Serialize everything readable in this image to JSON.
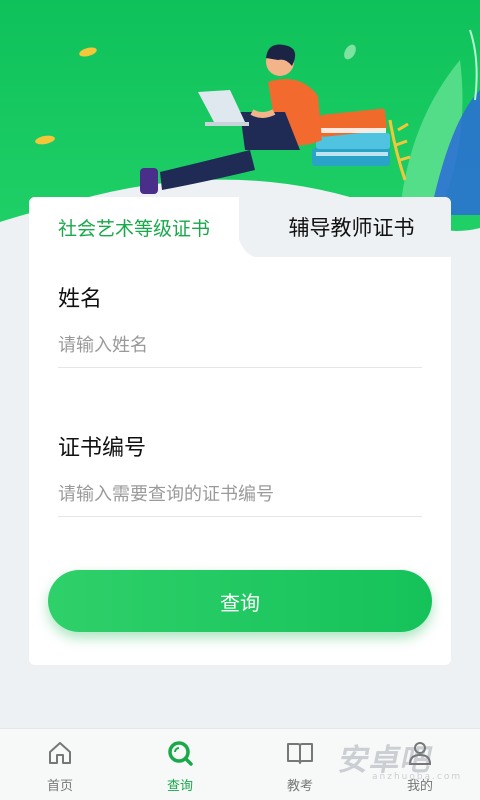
{
  "colors": {
    "brand_green": "#19a94a",
    "hero_green": "#16c25a",
    "background": "#eef1f3"
  },
  "tabs": [
    {
      "label": "社会艺术等级证书",
      "active": true
    },
    {
      "label": "辅导教师证书",
      "active": false
    }
  ],
  "form": {
    "name_label": "姓名",
    "name_placeholder": "请输入姓名",
    "cert_label": "证书编号",
    "cert_placeholder": "请输入需要查询的证书编号"
  },
  "query_button_label": "查询",
  "nav": [
    {
      "label": "首页",
      "icon": "home-icon",
      "active": false
    },
    {
      "label": "查询",
      "icon": "search-icon",
      "active": true
    },
    {
      "label": "教考",
      "icon": "book-icon",
      "active": false
    },
    {
      "label": "我的",
      "icon": "user-icon",
      "active": false
    }
  ],
  "watermark": {
    "text": "安卓吧",
    "sub": "anzhuoba.com"
  }
}
